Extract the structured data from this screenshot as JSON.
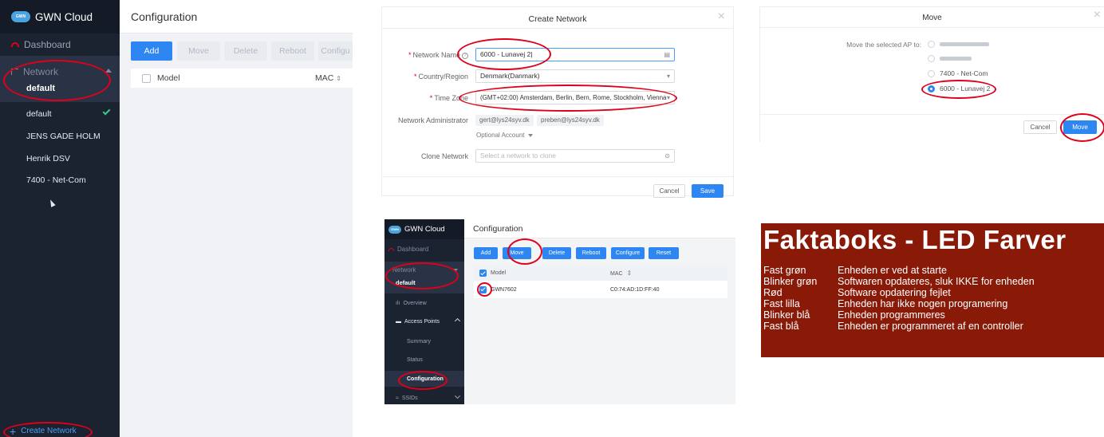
{
  "panel_a": {
    "app_title": "GWN Cloud",
    "logo_text": "GWN",
    "dashboard_label": "Dashboard",
    "network_label": "Network",
    "network_value": "default",
    "network_items": [
      "default",
      "JENS GADE HOLM",
      "Henrik DSV",
      "7400 - Net-Com"
    ],
    "create_network": "Create Network",
    "page_title": "Configuration",
    "buttons": {
      "add": "Add",
      "move": "Move",
      "delete": "Delete",
      "reboot": "Reboot",
      "configure": "Configu"
    },
    "columns": {
      "model": "Model",
      "mac": "MAC"
    }
  },
  "panel_b": {
    "title": "Create Network",
    "network_name_label": "Network Name",
    "network_name_value": "6000 - Lunavej 2",
    "country_label": "Country/Region",
    "country_value": "Denmark(Danmark)",
    "timezone_label": "Time Zone",
    "timezone_value": "(GMT+02:00) Amsterdam, Berlin, Bern, Rome, Stockholm, Vienna",
    "admin_label": "Network Administrator",
    "admin_chips": [
      "gert@lys24syv.dk",
      "preben@lys24syv.dk"
    ],
    "optional_account": "Optional Account",
    "clone_label": "Clone Network",
    "clone_placeholder": "Select a network to clone",
    "cancel": "Cancel",
    "save": "Save"
  },
  "panel_c": {
    "title": "Move",
    "label": "Move the selected AP to:",
    "options": [
      "7400 - Net-Com",
      "6000 - Lunavej 2"
    ],
    "cancel": "Cancel",
    "move": "Move"
  },
  "panel_d": {
    "app_title": "GWN Cloud",
    "logo_text": "GWN",
    "dashboard_label": "Dashboard",
    "network_label": "Network",
    "network_value": "default",
    "overview": "Overview",
    "access_points": "Access Points",
    "summary": "Summary",
    "status": "Status",
    "configuration": "Configuration",
    "ssids": "SSIDs",
    "page_title": "Configuration",
    "buttons": {
      "add": "Add",
      "move": "Move",
      "delete": "Delete",
      "reboot": "Reboot",
      "configure": "Configure",
      "reset": "Reset"
    },
    "columns": {
      "model": "Model",
      "mac": "MAC"
    },
    "row": {
      "model": "GWN7602",
      "mac": "C0:74:AD:1D:FF:40"
    }
  },
  "panel_e": {
    "title": "Faktaboks - LED Farver",
    "rows": [
      {
        "term": "Fast grøn",
        "desc": "Enheden er ved at starte"
      },
      {
        "term": "Blinker grøn",
        "desc": "Softwaren opdateres, sluk IKKE for enheden"
      },
      {
        "term": "Rød",
        "desc": "Software opdatering fejlet"
      },
      {
        "term": "Fast lilla",
        "desc": "Enheden har ikke nogen programering"
      },
      {
        "term": "Blinker blå",
        "desc": "Enheden programmeres"
      },
      {
        "term": "Fast blå",
        "desc": "Enheden er programmeret af en controller"
      }
    ]
  },
  "colors": {
    "accent": "#2e86f2",
    "sidebar": "#1b2230",
    "highlight_ring": "#e0001b",
    "fact_box": "#8a1a08",
    "success": "#3cc88a"
  }
}
